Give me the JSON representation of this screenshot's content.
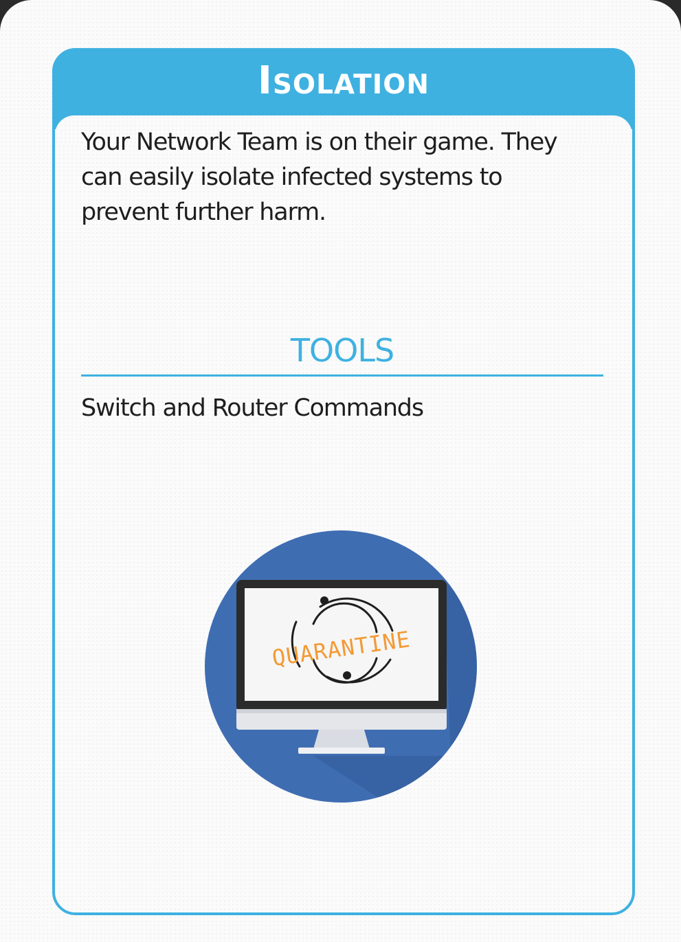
{
  "card": {
    "title": "Isolation",
    "description": "Your Network Team is on their game. They can easily isolate infected systems to prevent further harm.",
    "tools_heading": "TOOLS",
    "tools": [
      "Switch and Router Commands"
    ],
    "illustration": {
      "icon": "monitor-quarantine-icon",
      "screen_text": "QUARANTINE"
    }
  },
  "colors": {
    "accent": "#3eb1e1",
    "circle": "#3f6db2",
    "quarantine_text": "#f39a35"
  }
}
